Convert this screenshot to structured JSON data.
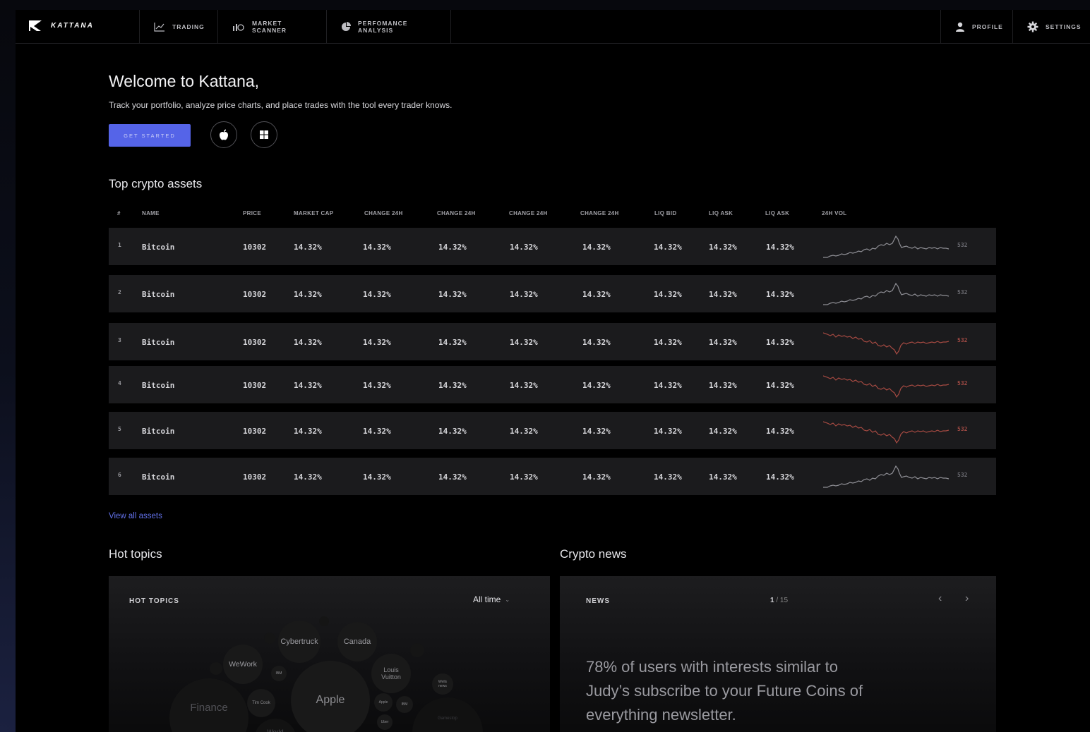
{
  "nav": {
    "logo": "KATTANA",
    "items": [
      "TRADING",
      "MARKET SCANNER",
      "PERFOMANCE ANALYSIS"
    ],
    "profile": "PROFILE",
    "settings": "SETTINGS"
  },
  "hero": {
    "title": "Welcome to Kattana,",
    "subtitle": "Track your portfolio, analyze price charts, and place trades with the tool every trader knows.",
    "cta": "GET STARTED"
  },
  "assets": {
    "title": "Top crypto assets",
    "columns": [
      "#",
      "NAME",
      "PRICE",
      "MARKET CAP",
      "CHANGE 24H",
      "CHANGE 24H",
      "CHANGE 24H",
      "CHANGE 24H",
      "LIQ BID",
      "LIQ ASK",
      "LIQ ASK",
      "24H VOL"
    ],
    "rows": [
      {
        "rank": "1",
        "name": "Bitcoin",
        "price": "10302",
        "cells": [
          "14.32%",
          "14.32%",
          "14.32%",
          "14.32%",
          "14.32%",
          "14.32%",
          "14.32%",
          "14.32%"
        ],
        "vol": "532",
        "trend": "up"
      },
      {
        "rank": "2",
        "name": "Bitcoin",
        "price": "10302",
        "cells": [
          "14.32%",
          "14.32%",
          "14.32%",
          "14.32%",
          "14.32%",
          "14.32%",
          "14.32%",
          "14.32%"
        ],
        "vol": "532",
        "trend": "up"
      },
      {
        "rank": "3",
        "name": "Bitcoin",
        "price": "10302",
        "cells": [
          "14.32%",
          "14.32%",
          "14.32%",
          "14.32%",
          "14.32%",
          "14.32%",
          "14.32%",
          "14.32%"
        ],
        "vol": "532",
        "trend": "down"
      },
      {
        "rank": "4",
        "name": "Bitcoin",
        "price": "10302",
        "cells": [
          "14.32%",
          "14.32%",
          "14.32%",
          "14.32%",
          "14.32%",
          "14.32%",
          "14.32%",
          "14.32%"
        ],
        "vol": "532",
        "trend": "down"
      },
      {
        "rank": "5",
        "name": "Bitcoin",
        "price": "10302",
        "cells": [
          "14.32%",
          "14.32%",
          "14.32%",
          "14.32%",
          "14.32%",
          "14.32%",
          "14.32%",
          "14.32%"
        ],
        "vol": "532",
        "trend": "down"
      },
      {
        "rank": "6",
        "name": "Bitcoin",
        "price": "10302",
        "cells": [
          "14.32%",
          "14.32%",
          "14.32%",
          "14.32%",
          "14.32%",
          "14.32%",
          "14.32%",
          "14.32%"
        ],
        "vol": "532",
        "trend": "up"
      }
    ],
    "view_all": "View all assets"
  },
  "hot_topics": {
    "title": "Hot topics",
    "label": "HOT TOPICS",
    "filter": "All time",
    "bubbles": [
      "Cybertruck",
      "Canada",
      "WeWork",
      "Louis Vuitton",
      "Apple",
      "Finance",
      "World",
      "Tim Cook",
      "IBM",
      "IBM",
      "Apple",
      "Uber",
      "Wells news",
      "Gamestop"
    ]
  },
  "news": {
    "title": "Crypto news",
    "label": "NEWS",
    "page_current": "1",
    "page_total": "15",
    "headline": "78% of users with interests similar to Judy’s subscribe to your Future Coins of everything newsletter."
  },
  "colors": {
    "accent": "#5564e8",
    "up_trend": "#8e8e94",
    "down_trend": "#a64a42"
  }
}
